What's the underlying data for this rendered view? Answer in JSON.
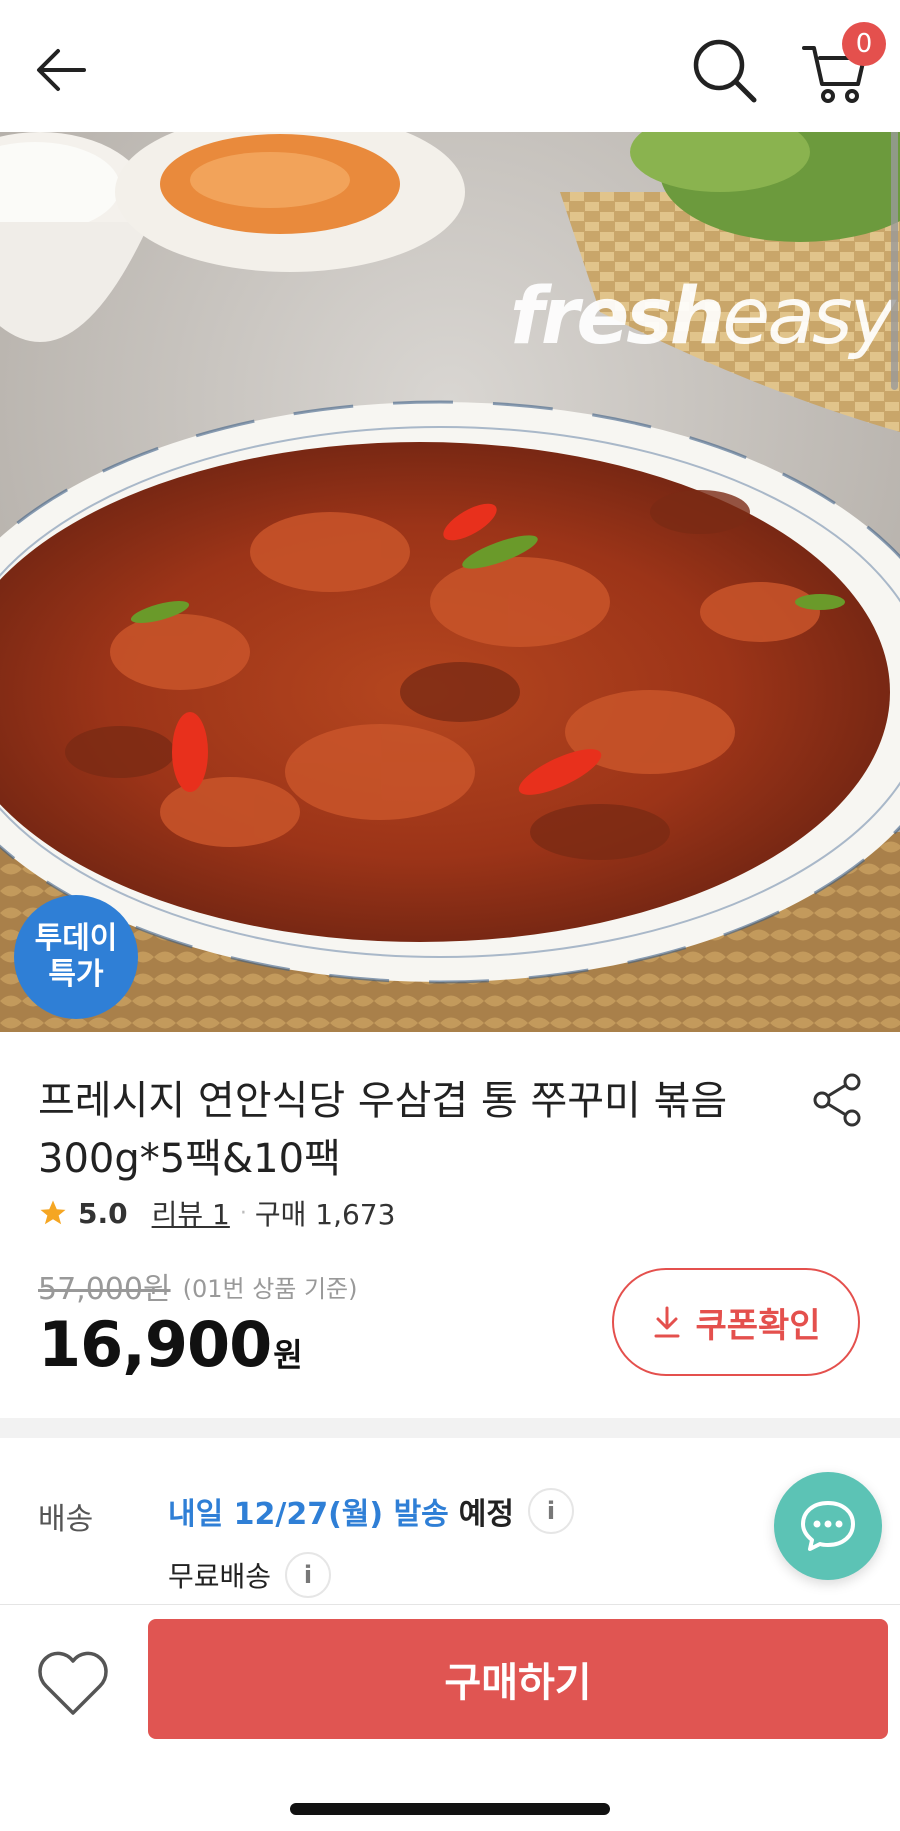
{
  "header": {
    "back_icon": "arrow-left-icon",
    "search_icon": "search-icon",
    "cart_icon": "cart-icon",
    "cart_count": "0"
  },
  "hero": {
    "brand_logo_bold": "fresh",
    "brand_logo_light": "easy",
    "badge_line1": "투데이",
    "badge_line2": "특가"
  },
  "product": {
    "title": "프레시지 연안식당 우삼겹 통 쭈꾸미 볶음 300g*5팩&10팩",
    "rating": "5.0",
    "review_label": "리뷰 1",
    "purchase_label": "구매 1,673",
    "original_price": "57,000원",
    "original_note": "(01번 상품 기준)",
    "sale_price": "16,900",
    "sale_unit": "원",
    "coupon_label": "쿠폰확인"
  },
  "shipping": {
    "label": "배송",
    "date_text": "내일 12/27(월) 발송",
    "expected_text": "예정",
    "free_text": "무료배송",
    "info_glyph": "i"
  },
  "bottom": {
    "buy_label": "구매하기",
    "wish_icon": "heart-icon"
  },
  "colors": {
    "accent": "#e05552",
    "link_blue": "#2f7fd6",
    "chat_fab": "#5cc3b5"
  }
}
